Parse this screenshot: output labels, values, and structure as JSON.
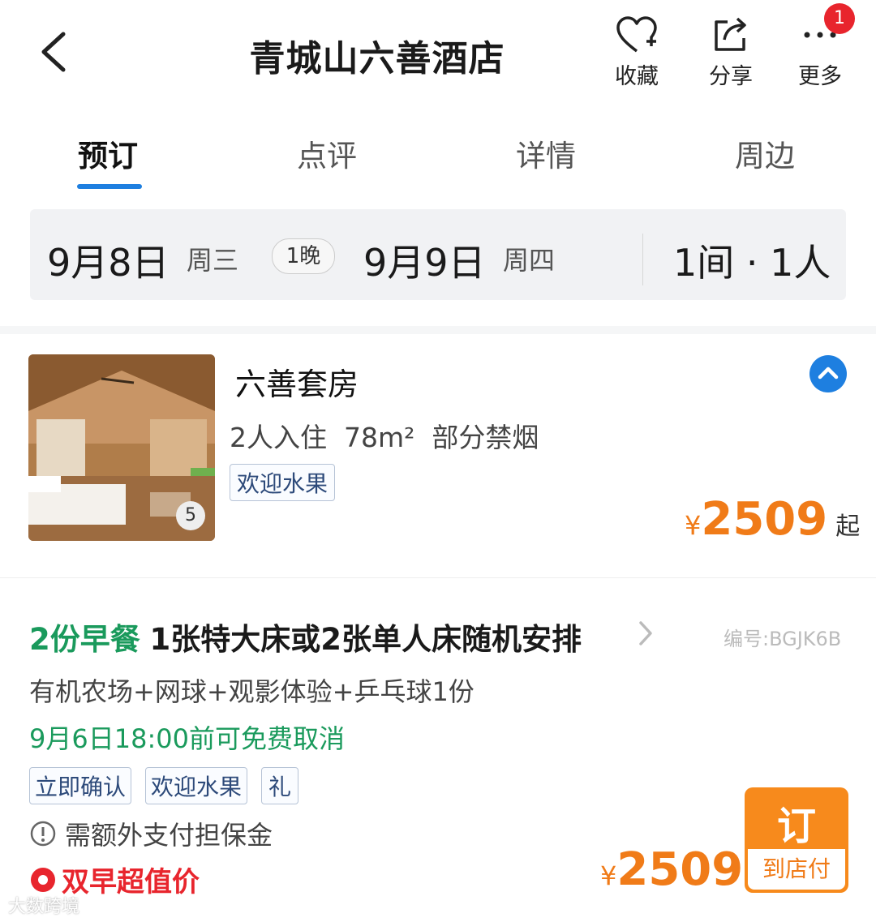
{
  "header": {
    "title": "青城山六善酒店",
    "favorite_label": "收藏",
    "share_label": "分享",
    "more_label": "更多",
    "more_badge": "1"
  },
  "tabs": [
    {
      "label": "预订",
      "active": true
    },
    {
      "label": "点评",
      "active": false
    },
    {
      "label": "详情",
      "active": false
    },
    {
      "label": "周边",
      "active": false
    }
  ],
  "dates": {
    "checkin": "9月8日",
    "checkin_weekday": "周三",
    "nights": "1晚",
    "checkout": "9月9日",
    "checkout_weekday": "周四",
    "rooms_guests": "1间 · 1人"
  },
  "room": {
    "photo_count": "5",
    "name": "六善套房",
    "occupancy": "2人入住",
    "area": "78m²",
    "smoking": "部分禁烟",
    "tag": "欢迎水果",
    "currency": "¥",
    "price": "2509",
    "price_suffix": "起"
  },
  "plan": {
    "breakfast": "2份早餐",
    "bed": "1张特大床或2张单人床随机安排",
    "code": "编号:BGJK6B",
    "extras": "有机农场+网球+观影体验+乒乓球1份",
    "cancel": "9月6日18:00前可免费取消",
    "tags": [
      "立即确认",
      "欢迎水果",
      "礼"
    ],
    "deposit": "需额外支付担保金",
    "promo": "双早超值价",
    "currency": "¥",
    "price": "2509",
    "book_label": "订",
    "pay_label": "到店付"
  },
  "watermark": "大数跨境",
  "colors": {
    "accent_blue": "#1e7fe0",
    "price_orange": "#f07b18",
    "green": "#1a9a5c",
    "badge_red": "#e8252d"
  }
}
